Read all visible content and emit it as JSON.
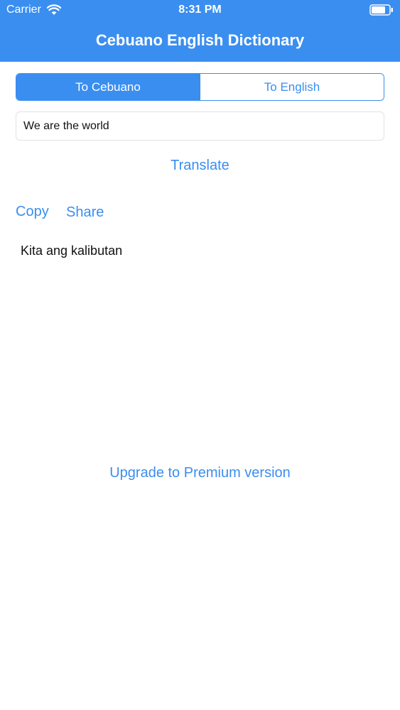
{
  "status_bar": {
    "carrier": "Carrier",
    "time": "8:31 PM",
    "wifi_icon": "wifi-icon",
    "battery_icon": "battery-icon"
  },
  "nav": {
    "title": "Cebuano English Dictionary"
  },
  "segmented_control": {
    "options": [
      {
        "label": "To Cebuano",
        "selected": true
      },
      {
        "label": "To English",
        "selected": false
      }
    ]
  },
  "input": {
    "value": "We are the world",
    "placeholder": ""
  },
  "actions": {
    "translate_label": "Translate",
    "copy_label": "Copy",
    "share_label": "Share",
    "upgrade_label": "Upgrade to Premium version"
  },
  "result": {
    "text": "Kita ang kalibutan"
  },
  "colors": {
    "accent": "#3a8ef0",
    "background": "#ffffff",
    "text": "#111111"
  }
}
